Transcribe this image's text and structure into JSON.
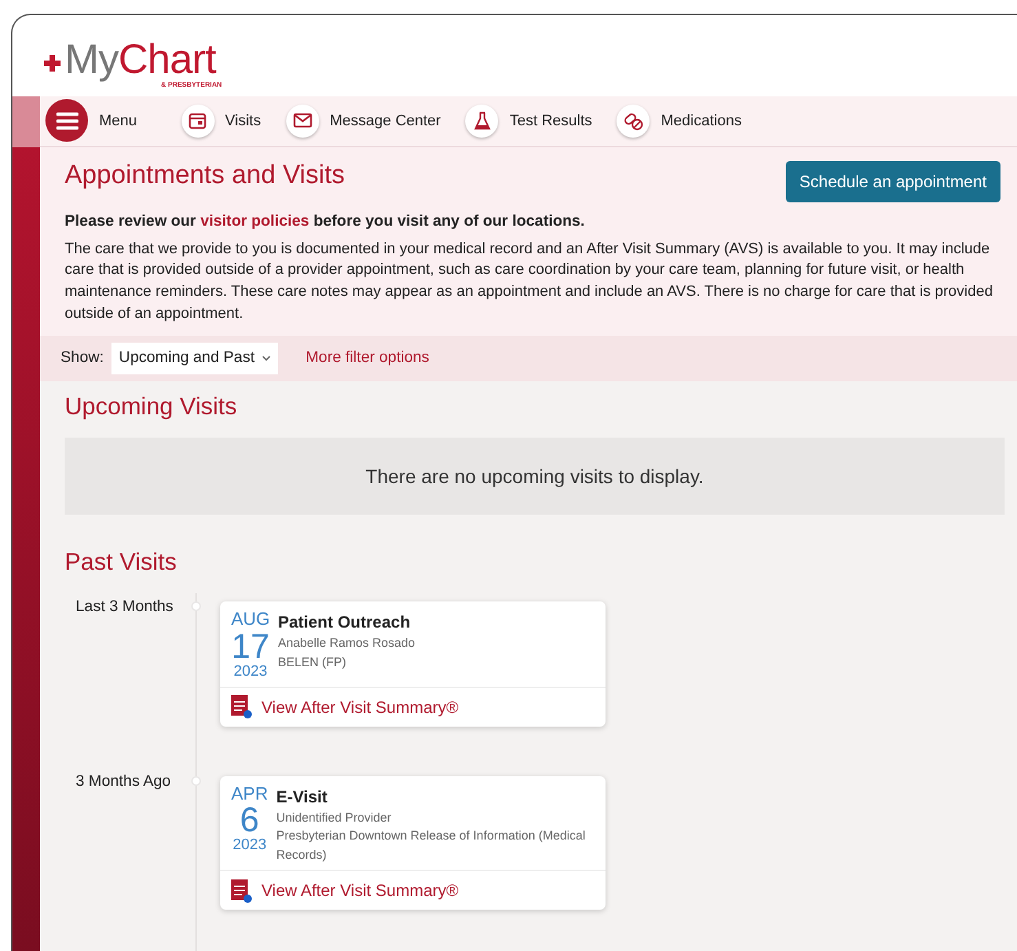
{
  "logo": {
    "prefix": "My",
    "main": "Chart",
    "tagline": "& PRESBYTERIAN"
  },
  "nav": [
    {
      "kind": "menu",
      "label": "Menu"
    },
    {
      "kind": "calendar",
      "label": "Visits"
    },
    {
      "kind": "envelope",
      "label": "Message Center"
    },
    {
      "kind": "flask",
      "label": "Test Results"
    },
    {
      "kind": "pills",
      "label": "Medications"
    }
  ],
  "page": {
    "title": "Appointments and Visits",
    "action": "Schedule an appointment",
    "notice_parts": [
      "Please review our ",
      "visitor policies",
      " before you visit any of our locations."
    ],
    "description": "The care that we provide to you is documented in your medical record and an After Visit Summary (AVS) is available to you. It may include care that is provided outside of a provider appointment, such as care coordination by your care team, planning for future visit, or health maintenance reminders. These care notes may appear as an appointment and include an AVS. There is no charge for care that is provided outside of an appointment."
  },
  "filter": {
    "label": "Show:",
    "value": "Upcoming and Past",
    "more": "More filter options"
  },
  "upcoming": {
    "title": "Upcoming Visits",
    "empty": "There are no upcoming visits to display."
  },
  "past": {
    "title": "Past Visits",
    "groups": [
      {
        "label": "Last 3 Months",
        "visits": [
          {
            "month": "AUG",
            "day": "17",
            "year": "2023",
            "type": "Patient Outreach",
            "lines": [
              "Anabelle Ramos Rosado",
              "BELEN (FP)"
            ],
            "link": "View After Visit Summary®"
          }
        ]
      },
      {
        "label": "3 Months Ago",
        "visits": [
          {
            "month": "APR",
            "day": "6",
            "year": "2023",
            "type": "E-Visit",
            "lines": [
              "Unidentified Provider",
              "Presbyterian Downtown Release of Information (Medical Records)"
            ],
            "link": "View After Visit Summary®"
          }
        ]
      }
    ]
  }
}
